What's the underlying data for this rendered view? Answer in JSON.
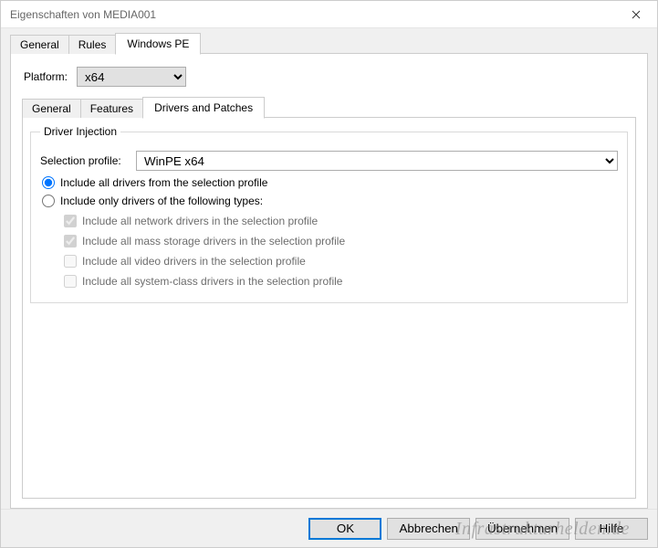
{
  "window": {
    "title": "Eigenschaften von MEDIA001"
  },
  "outerTabs": {
    "general": "General",
    "rules": "Rules",
    "windowsPE": "Windows PE"
  },
  "platform": {
    "label": "Platform:",
    "value": "x64"
  },
  "innerTabs": {
    "general": "General",
    "features": "Features",
    "driversPatches": "Drivers and Patches"
  },
  "group": {
    "legend": "Driver Injection",
    "selectionProfileLabel": "Selection profile:",
    "selectionProfileValue": "WinPE x64",
    "radioAll": "Include all drivers from the selection profile",
    "radioTypes": "Include only drivers of the following types:",
    "checkNetwork": "Include all network drivers in the selection profile",
    "checkStorage": "Include all mass storage drivers in the selection profile",
    "checkVideo": "Include all video drivers in the selection profile",
    "checkSystem": "Include all system-class drivers in the selection profile"
  },
  "buttons": {
    "ok": "OK",
    "cancel": "Abbrechen",
    "apply": "Übernehmen",
    "help": "Hilfe"
  },
  "watermark": "Infrastrukturhelden.de"
}
